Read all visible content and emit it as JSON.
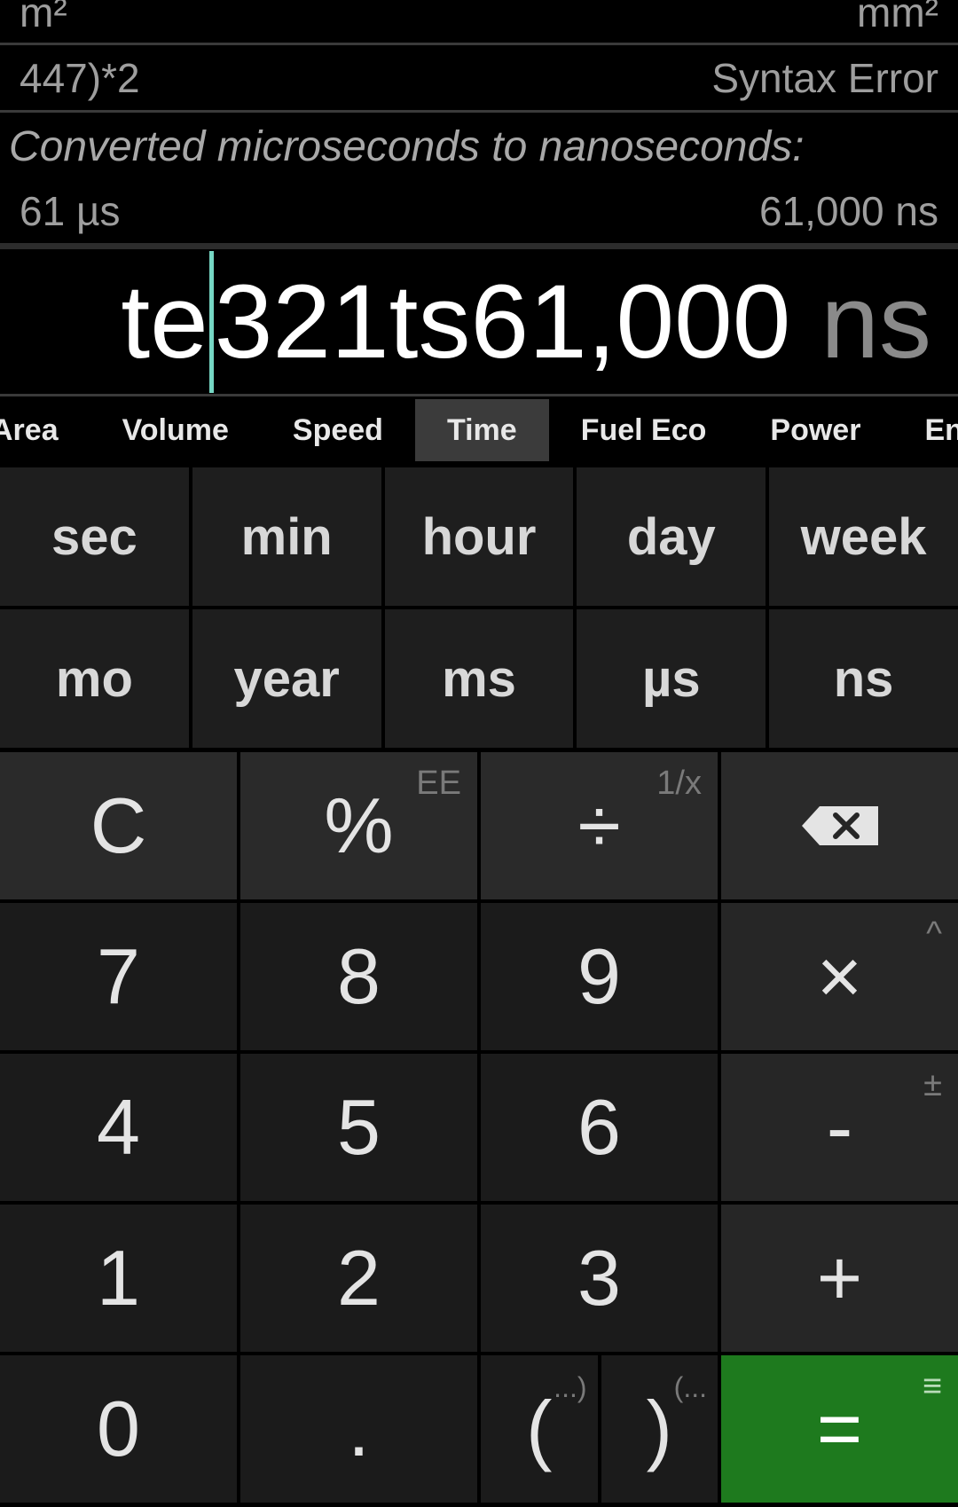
{
  "history": {
    "row1": {
      "left": "m²",
      "right": "mm²"
    },
    "row2": {
      "left": "447)*2",
      "right": "Syntax Error"
    },
    "conversion_note": "Converted microseconds to nanoseconds:",
    "row3": {
      "left": "61 µs",
      "right": "61,000 ns"
    }
  },
  "display": {
    "before_cursor": "te",
    "after_cursor": "321ts61,000",
    "unit": "ns"
  },
  "tabs": [
    {
      "label": "Area"
    },
    {
      "label": "Volume"
    },
    {
      "label": "Speed"
    },
    {
      "label": "Time",
      "active": true
    },
    {
      "label": "Fuel Eco"
    },
    {
      "label": "Power"
    },
    {
      "label": "Ene"
    }
  ],
  "units": [
    {
      "label": "sec"
    },
    {
      "label": "min"
    },
    {
      "label": "hour"
    },
    {
      "label": "day"
    },
    {
      "label": "week"
    },
    {
      "label": "mo"
    },
    {
      "label": "year"
    },
    {
      "label": "ms"
    },
    {
      "label": "µs"
    },
    {
      "label": "ns"
    }
  ],
  "keys": {
    "clear": "C",
    "percent": "%",
    "percent_alt": "EE",
    "divide": "÷",
    "divide_alt": "1/x",
    "seven": "7",
    "eight": "8",
    "nine": "9",
    "multiply": "×",
    "multiply_alt": "^",
    "four": "4",
    "five": "5",
    "six": "6",
    "minus": "-",
    "minus_alt": "±",
    "one": "1",
    "two": "2",
    "three": "3",
    "plus": "+",
    "zero": "0",
    "decimal": ".",
    "open_paren": "(",
    "open_paren_alt": "...)",
    "close_paren": ")",
    "close_paren_alt": "(...",
    "equals": "=",
    "equals_alt": "≡"
  },
  "colors": {
    "background": "#000000",
    "equals_key": "#1e7a1e",
    "cursor": "#76d7c4",
    "active_tab": "#3b3b3b"
  },
  "icons": {
    "backspace": "backspace-icon"
  }
}
